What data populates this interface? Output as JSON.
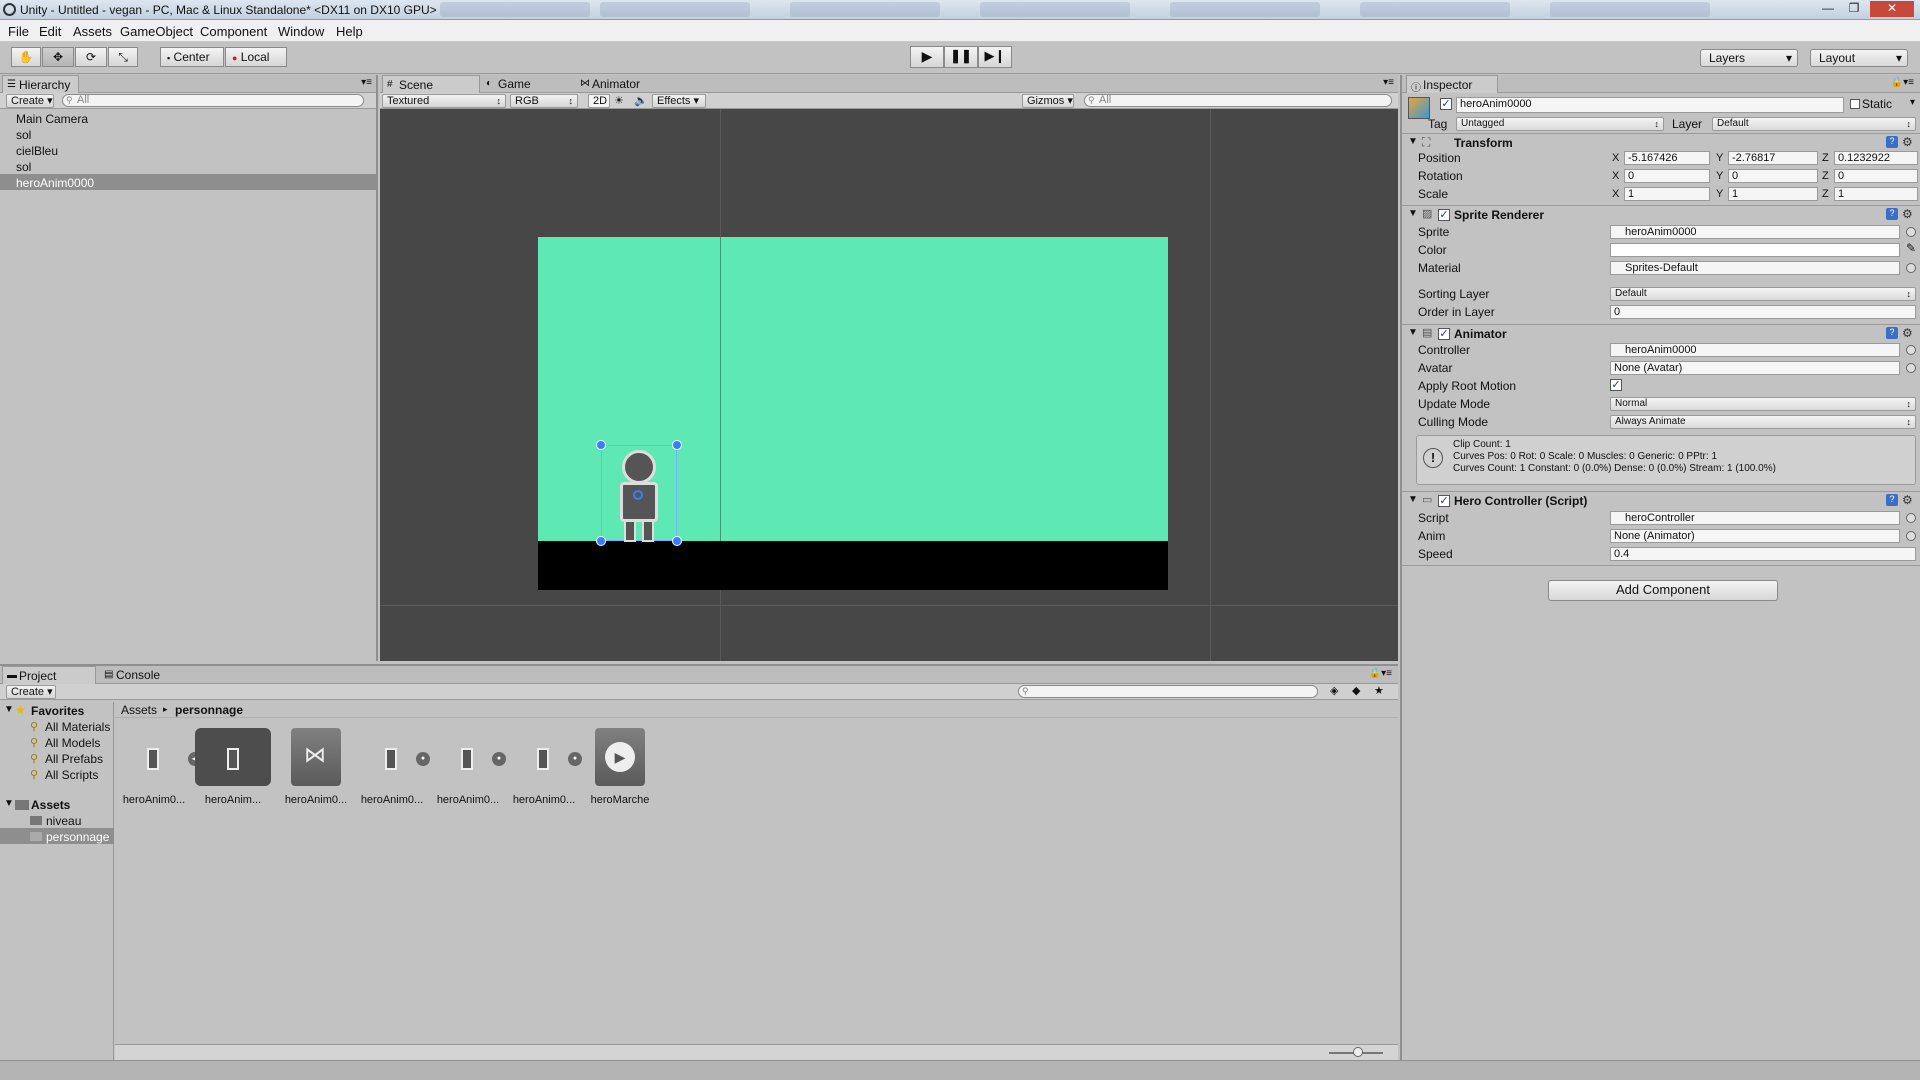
{
  "window": {
    "title": "Unity - Untitled - vegan - PC, Mac & Linux Standalone* <DX11 on DX10 GPU>",
    "minimize": "—",
    "maximize": "❐",
    "close": "✕"
  },
  "menu": [
    "File",
    "Edit",
    "Assets",
    "GameObject",
    "Component",
    "Window",
    "Help"
  ],
  "toolbar": {
    "pivot": "Center",
    "space": "Local",
    "layers": "Layers",
    "layout": "Layout"
  },
  "hierarchy": {
    "tab": "Hierarchy",
    "create": "Create",
    "search_placeholder": "All",
    "items": [
      "Main Camera",
      "sol",
      "cielBleu",
      "sol",
      "heroAnim0000"
    ],
    "selected_index": 4
  },
  "scene": {
    "tabs": [
      "Scene",
      "Game",
      "Animator"
    ],
    "draw_mode": "Textured",
    "render_mode": "RGB",
    "mode_2d": "2D",
    "effects": "Effects",
    "gizmos": "Gizmos",
    "search_placeholder": "All",
    "sky_color": "#5de8b4",
    "ground_color": "#000000",
    "background_color": "#474747"
  },
  "inspector": {
    "tab": "Inspector",
    "object_name": "heroAnim0000",
    "static_label": "Static",
    "tag_label": "Tag",
    "tag_value": "Untagged",
    "layer_label": "Layer",
    "layer_value": "Default",
    "transform": {
      "title": "Transform",
      "rows": [
        {
          "label": "Position",
          "x": "-5.167426",
          "y": "-2.76817",
          "z": "0.1232922"
        },
        {
          "label": "Rotation",
          "x": "0",
          "y": "0",
          "z": "0"
        },
        {
          "label": "Scale",
          "x": "1",
          "y": "1",
          "z": "1"
        }
      ]
    },
    "sprite_renderer": {
      "title": "Sprite Renderer",
      "sprite_label": "Sprite",
      "sprite_value": "heroAnim0000",
      "color_label": "Color",
      "material_label": "Material",
      "material_value": "Sprites-Default",
      "sorting_label": "Sorting Layer",
      "sorting_value": "Default",
      "order_label": "Order in Layer",
      "order_value": "0"
    },
    "animator": {
      "title": "Animator",
      "controller_label": "Controller",
      "controller_value": "heroAnim0000",
      "avatar_label": "Avatar",
      "avatar_value": "None (Avatar)",
      "root_motion_label": "Apply Root Motion",
      "update_label": "Update Mode",
      "update_value": "Normal",
      "culling_label": "Culling Mode",
      "culling_value": "Always Animate",
      "info_line1": "Clip Count: 1",
      "info_line2": "Curves Pos: 0 Rot: 0 Scale: 0 Muscles: 0 Generic: 0 PPtr: 1",
      "info_line3": "Curves Count: 1 Constant: 0 (0.0%) Dense: 0 (0.0%) Stream: 1 (100.0%)"
    },
    "hero_controller": {
      "title": "Hero Controller (Script)",
      "script_label": "Script",
      "script_value": "heroController",
      "anim_label": "Anim",
      "anim_value": "None (Animator)",
      "speed_label": "Speed",
      "speed_value": "0.4"
    },
    "add_component": "Add Component"
  },
  "project": {
    "tabs": [
      "Project",
      "Console"
    ],
    "create": "Create",
    "breadcrumb": [
      "Assets",
      "personnage"
    ],
    "favorites_label": "Favorites",
    "favorites": [
      "All Materials",
      "All Models",
      "All Prefabs",
      "All Scripts"
    ],
    "assets_label": "Assets",
    "folders": [
      "niveau",
      "personnage"
    ],
    "selected_folder": "personnage",
    "assets": [
      "heroAnim0...",
      "heroAnim...",
      "heroAnim0...",
      "heroAnim0...",
      "heroAnim0...",
      "heroAnim0...",
      "heroMarche"
    ]
  }
}
